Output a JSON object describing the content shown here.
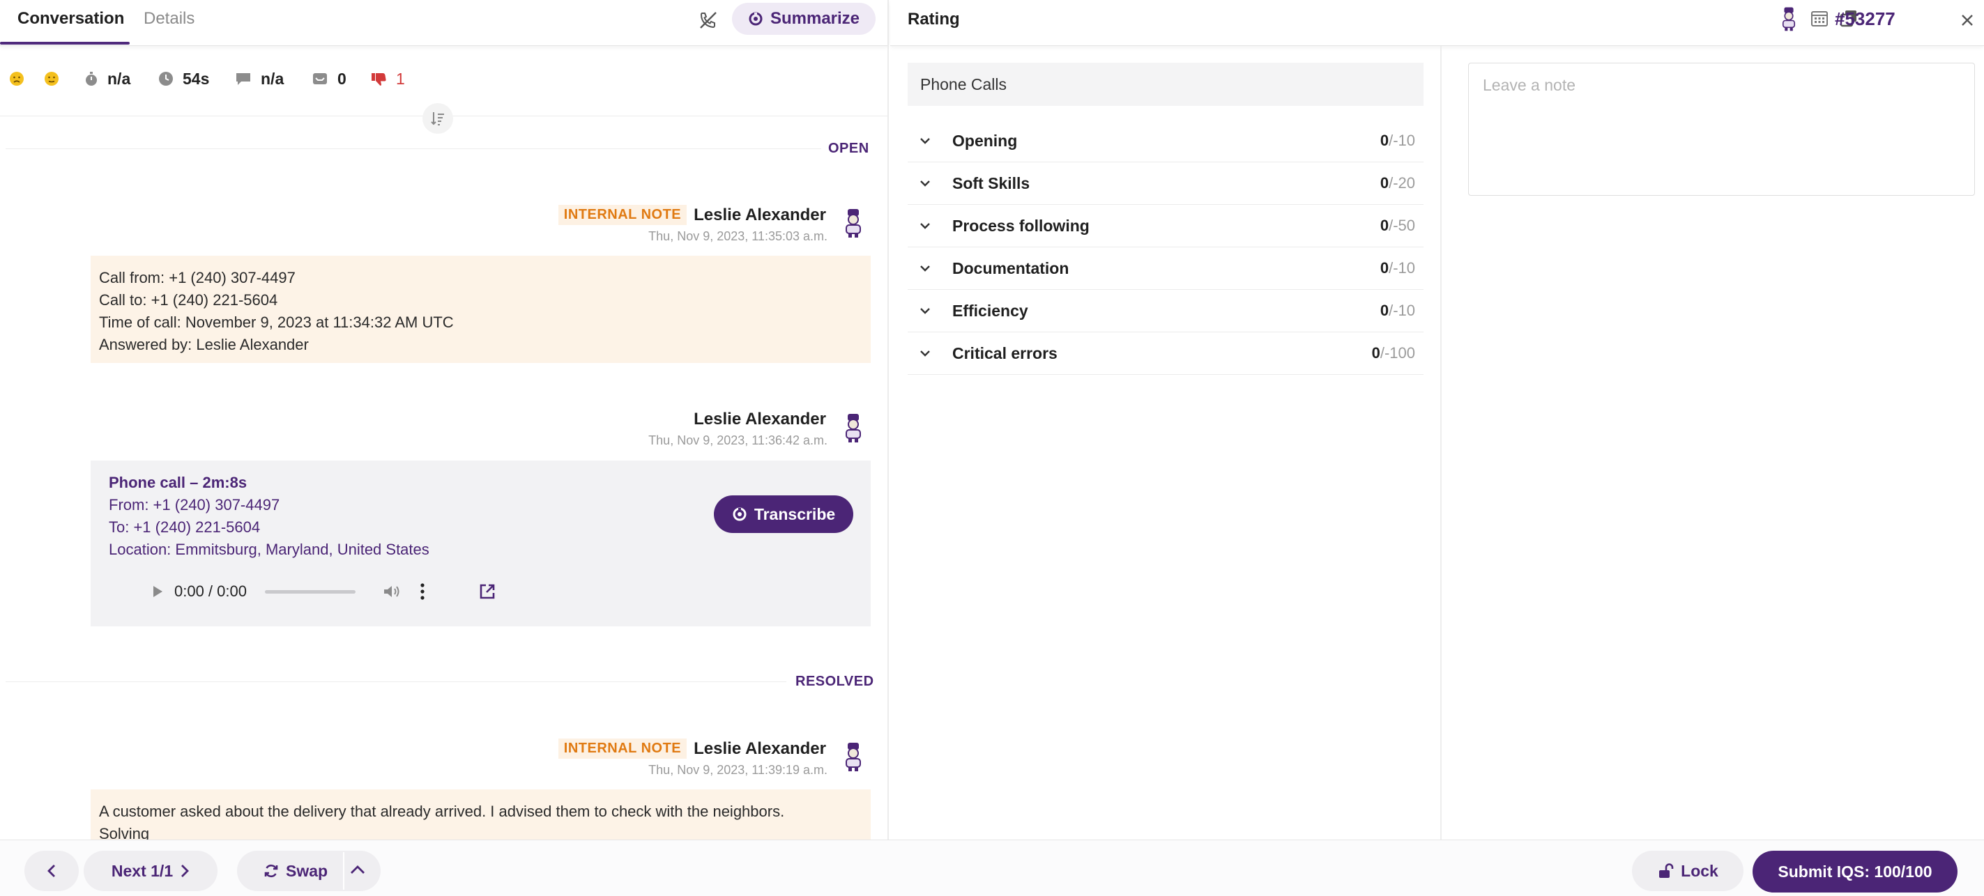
{
  "tabs": {
    "conversation": "Conversation",
    "details": "Details"
  },
  "summarize_label": "Summarize",
  "stats": [
    {
      "icon": "sad-face-icon",
      "value": ""
    },
    {
      "icon": "neutral-face-icon",
      "value": ""
    },
    {
      "icon": "stopwatch-icon",
      "value": "n/a"
    },
    {
      "icon": "clock-icon",
      "value": "54s"
    },
    {
      "icon": "chat-bubble-icon",
      "value": "n/a"
    },
    {
      "icon": "inbox-icon",
      "value": "0"
    },
    {
      "icon": "thumbs-down-icon",
      "value": "1"
    }
  ],
  "conversation": {
    "status_open": "OPEN",
    "status_resolved": "RESOLVED",
    "msg1": {
      "tag": "INTERNAL NOTE",
      "author": "Leslie Alexander",
      "time": "Thu, Nov 9, 2023, 11:35:03 a.m.",
      "lines": [
        "Call from: +1 (240) 307-4497",
        "Call to: +1 (240) 221-5604",
        "Time of call: November 9, 2023 at 11:34:32 AM UTC",
        "Answered by: Leslie Alexander"
      ]
    },
    "msg2": {
      "author": "Leslie Alexander",
      "time": "Thu, Nov 9, 2023, 11:36:42 a.m.",
      "call_title": "Phone call – 2m:8s",
      "lines": [
        "From: +1 (240) 307-4497",
        "To: +1 (240) 221-5604",
        "Location: Emmitsburg, Maryland, United States"
      ],
      "transcribe": "Transcribe",
      "audio_time": "0:00 / 0:00"
    },
    "msg3": {
      "tag": "INTERNAL NOTE",
      "author": "Leslie Alexander",
      "time": "Thu, Nov 9, 2023, 11:39:19 a.m.",
      "lines": [
        "A customer asked about the delivery that already arrived. I advised them to check with the neighbors.",
        "Solving"
      ]
    }
  },
  "bottom": {
    "next": "Next 1/1",
    "swap": "Swap",
    "lock": "Lock",
    "submit": "Submit IQS: 100/100"
  },
  "rating": {
    "title": "Rating",
    "ticket": "#53277",
    "category": "Phone Calls",
    "note_placeholder": "Leave a note",
    "rows": [
      {
        "name": "Opening",
        "got": "0",
        "max": "/-10"
      },
      {
        "name": "Soft Skills",
        "got": "0",
        "max": "/-20"
      },
      {
        "name": "Process following",
        "got": "0",
        "max": "/-50"
      },
      {
        "name": "Documentation",
        "got": "0",
        "max": "/-10"
      },
      {
        "name": "Efficiency",
        "got": "0",
        "max": "/-10"
      },
      {
        "name": "Critical errors",
        "got": "0",
        "max": "/-100"
      }
    ]
  },
  "colors": {
    "accent": "#4b2576",
    "note_bg": "#fdf3e7",
    "internal_tag": "#e07a12",
    "negative": "#d23a3a"
  }
}
